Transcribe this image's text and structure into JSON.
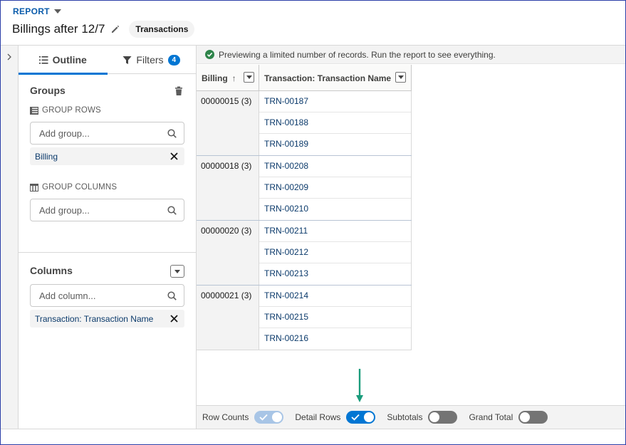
{
  "header": {
    "report_label": "REPORT",
    "title": "Billings after 12/7",
    "report_type": "Transactions"
  },
  "panel": {
    "tabs": [
      {
        "label": "Outline",
        "active": true
      },
      {
        "label": "Filters",
        "count": "4"
      }
    ],
    "groups": {
      "title": "Groups",
      "group_rows_label": "GROUP ROWS",
      "group_rows_placeholder": "Add group...",
      "group_rows_items": [
        "Billing"
      ],
      "group_columns_label": "GROUP COLUMNS",
      "group_columns_placeholder": "Add group..."
    },
    "columns": {
      "title": "Columns",
      "placeholder": "Add column...",
      "items": [
        "Transaction: Transaction Name"
      ]
    }
  },
  "notice": "Previewing a limited number of records. Run the report to see everything.",
  "table": {
    "headers": [
      "Billing",
      "Transaction: Transaction Name"
    ],
    "sort_indicator": "↑",
    "groups": [
      {
        "label": "00000015 (3)",
        "rows": [
          "TRN-00187",
          "TRN-00188",
          "TRN-00189"
        ]
      },
      {
        "label": "00000018 (3)",
        "rows": [
          "TRN-00208",
          "TRN-00209",
          "TRN-00210"
        ]
      },
      {
        "label": "00000020 (3)",
        "rows": [
          "TRN-00211",
          "TRN-00212",
          "TRN-00213"
        ]
      },
      {
        "label": "00000021 (3)",
        "rows": [
          "TRN-00214",
          "TRN-00215",
          "TRN-00216"
        ]
      }
    ]
  },
  "footer": {
    "toggles": [
      {
        "label": "Row Counts",
        "state": "on-disabled"
      },
      {
        "label": "Detail Rows",
        "state": "on"
      },
      {
        "label": "Subtotals",
        "state": "off"
      },
      {
        "label": "Grand Total",
        "state": "off"
      }
    ]
  },
  "colors": {
    "brand_blue": "#0176d3",
    "link_blue": "#0b5cab",
    "success_green": "#2e844a",
    "annotation_arrow": "#1a9c7c"
  }
}
